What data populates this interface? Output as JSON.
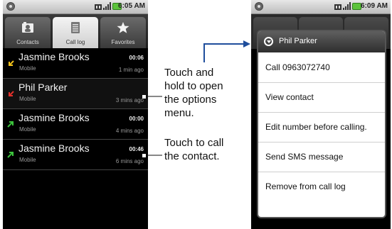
{
  "left_phone": {
    "status": {
      "time": "6:05 AM"
    },
    "tabs": [
      {
        "label": "Contacts",
        "icon": "contacts-icon"
      },
      {
        "label": "Call log",
        "icon": "call-log-icon"
      },
      {
        "label": "Favorites",
        "icon": "star-icon"
      }
    ],
    "calls": [
      {
        "name": "Jasmine Brooks",
        "type": "Mobile",
        "duration": "00:06",
        "ago": "1 min ago",
        "icon": "missed-call-arrow-icon"
      },
      {
        "name": "Phil Parker",
        "type": "Mobile",
        "duration": "",
        "ago": "3 mins ago",
        "icon": "missed-call-arrow-icon"
      },
      {
        "name": "Jasmine Brooks",
        "type": "Mobile",
        "duration": "00:00",
        "ago": "4 mins ago",
        "icon": "outgoing-call-arrow-icon"
      },
      {
        "name": "Jasmine Brooks",
        "type": "Mobile",
        "duration": "00:46",
        "ago": "6 mins ago",
        "icon": "outgoing-call-arrow-icon"
      }
    ]
  },
  "right_phone": {
    "status": {
      "time": "6:09 AM"
    },
    "menu": {
      "title": "Phil Parker",
      "items": [
        "Call 0963072740",
        "View contact",
        "Edit number before calling.",
        "Send SMS message",
        "Remove from call log"
      ]
    }
  },
  "callouts": {
    "hold": [
      "Touch and",
      "hold to open",
      "the options",
      "menu."
    ],
    "touch": [
      "Touch to call",
      "the contact."
    ]
  },
  "colors": {
    "arrow_blue": "#1f4e9c",
    "missed_yellow": "#f2c21b",
    "missed_red": "#e0302a",
    "outgoing_green": "#3cc43c"
  }
}
